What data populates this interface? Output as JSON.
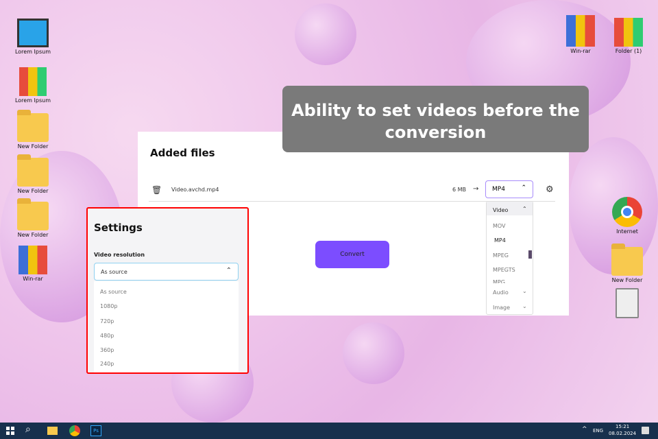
{
  "desktop": {
    "left": [
      "Lorem Ipsum",
      "Lorem Ipsum",
      "New Folder",
      "New Folder",
      "New Folder",
      "Win-rar"
    ],
    "right_top": [
      "Win-rar",
      "Folder (1)"
    ],
    "right": [
      "Internet",
      "New Folder"
    ]
  },
  "banner": "Ability to set videos before the conversion",
  "panel": {
    "title": "Added files",
    "file_name": "Video.avchd.mp4",
    "size": "6 MB",
    "format": "MP4",
    "convert": "Convert"
  },
  "format_dropdown": {
    "group": "Video",
    "items": [
      "MOV",
      "MP4",
      "MPEG",
      "MPEGTS",
      "MPG"
    ],
    "other_groups": [
      "Audio",
      "Image"
    ]
  },
  "settings": {
    "title": "Settings",
    "label": "Video resolution",
    "selected": "As source",
    "options": [
      "As source",
      "1080p",
      "720p",
      "480p",
      "360p",
      "240p"
    ]
  },
  "taskbar": {
    "lang": "ENG",
    "time": "15:21",
    "date": "08.02.2024"
  }
}
